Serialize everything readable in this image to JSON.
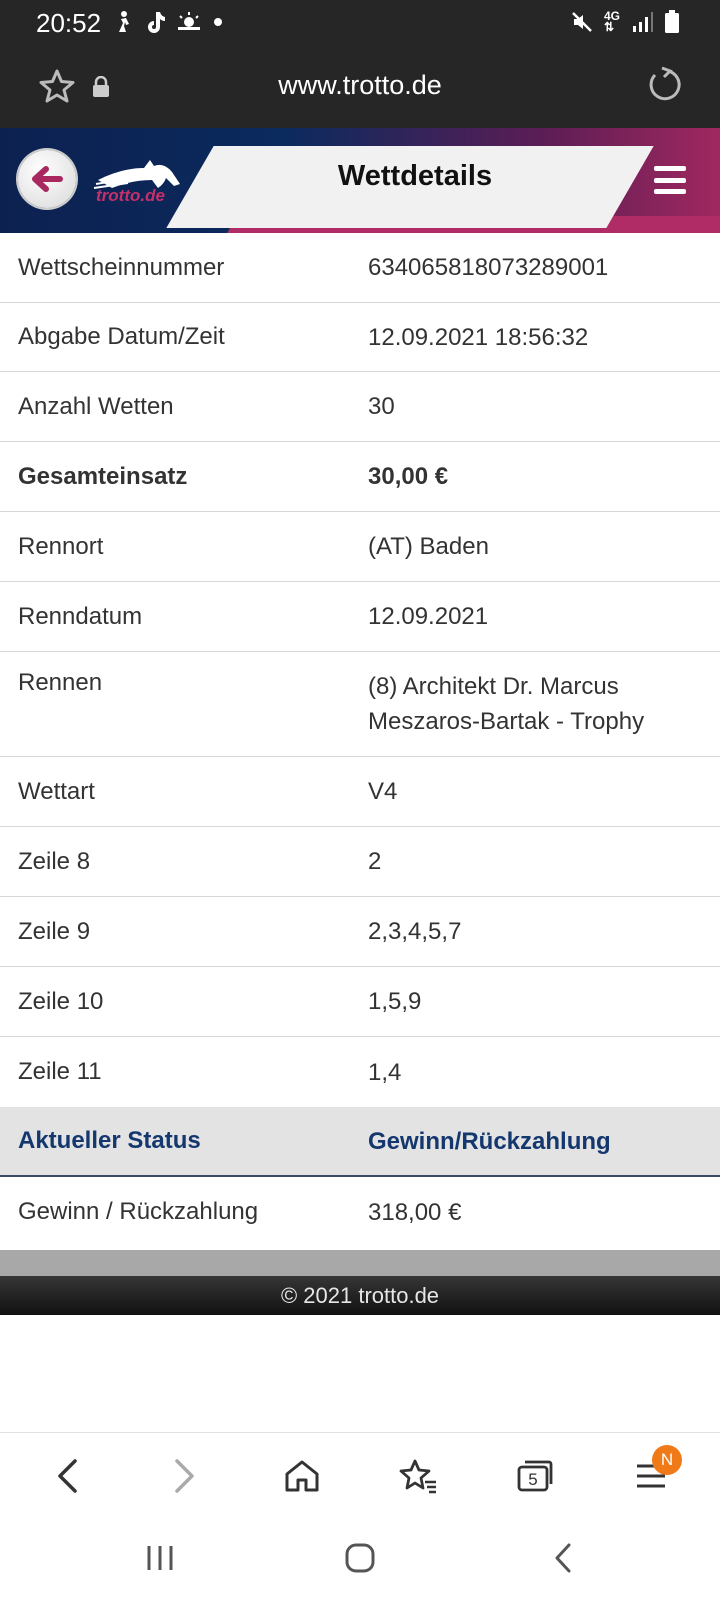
{
  "status_bar": {
    "time": "20:52",
    "notification_icons": [
      "walking-icon",
      "tiktok-icon",
      "weather-icon",
      "dot-icon"
    ],
    "system_icons": [
      "mute-icon",
      "network-4g-icon",
      "signal-icon",
      "battery-icon"
    ],
    "network_label": "4G"
  },
  "browser": {
    "url": "www.trotto.de",
    "tab_count": "5",
    "menu_badge": "N"
  },
  "header": {
    "title": "Wettdetails",
    "logo_text": "trotto.de"
  },
  "details": [
    {
      "label": "Wettscheinnummer",
      "value": "634065818073289001"
    },
    {
      "label": "Abgabe Datum/Zeit",
      "value": "12.09.2021 18:56:32"
    },
    {
      "label": "Anzahl Wetten",
      "value": "30"
    },
    {
      "label": "Gesamteinsatz",
      "value": "30,00 €"
    },
    {
      "label": "Rennort",
      "value": "(AT) Baden"
    },
    {
      "label": "Renndatum",
      "value": "12.09.2021"
    },
    {
      "label": "Rennen",
      "value": "(8) Architekt Dr. Marcus Meszaros-Bartak - Trophy"
    },
    {
      "label": "Wettart",
      "value": "V4"
    },
    {
      "label": "Zeile 8",
      "value": "2"
    },
    {
      "label": "Zeile 9",
      "value": "2,3,4,5,7"
    },
    {
      "label": "Zeile 10",
      "value": "1,5,9"
    },
    {
      "label": "Zeile 11",
      "value": "1,4"
    }
  ],
  "status": {
    "label": "Aktueller Status",
    "value": "Gewinn/Rückzahlung"
  },
  "payout": {
    "label": "Gewinn / Rückzahlung",
    "value": "318,00 €"
  },
  "footer": {
    "copyright": "© 2021 trotto.de"
  },
  "colors": {
    "header_navy": "#0c2150",
    "header_magenta": "#a0285f",
    "status_text": "#14376e",
    "badge": "#f07a18"
  }
}
